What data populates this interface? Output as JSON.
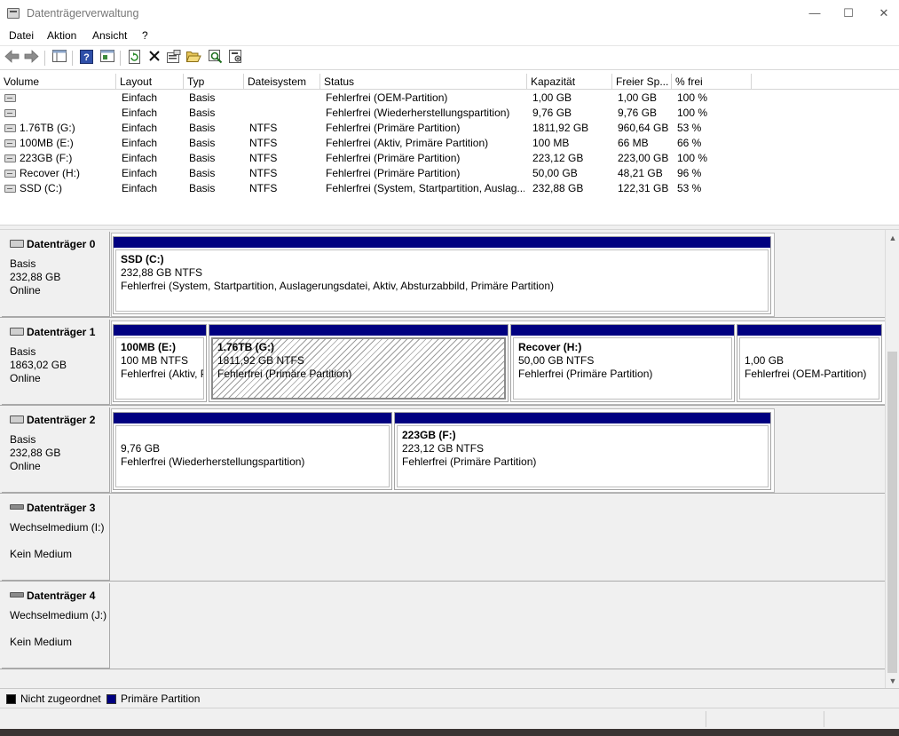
{
  "window": {
    "title": "Datenträgerverwaltung",
    "minimize_glyph": "—",
    "maximize_glyph": "☐",
    "close_glyph": "✕"
  },
  "menu": [
    "Datei",
    "Aktion",
    "Ansicht",
    "?"
  ],
  "toolbar": {
    "icons": [
      "back-arrow-icon",
      "forward-arrow-icon",
      "console-tree-icon",
      "help-icon",
      "details-pane-icon",
      "refresh-icon",
      "delete-icon",
      "properties-icon",
      "open-folder-icon",
      "rescan-icon",
      "settings-icon"
    ]
  },
  "volume_list": {
    "columns": [
      "Volume",
      "Layout",
      "Typ",
      "Dateisystem",
      "Status",
      "Kapazität",
      "Freier Sp...",
      "% frei"
    ],
    "rows": [
      {
        "volume": "",
        "layout": "Einfach",
        "typ": "Basis",
        "fs": "",
        "status": "Fehlerfrei (OEM-Partition)",
        "capacity": "1,00 GB",
        "free": "1,00 GB",
        "pct": "100 %"
      },
      {
        "volume": "",
        "layout": "Einfach",
        "typ": "Basis",
        "fs": "",
        "status": "Fehlerfrei (Wiederherstellungspartition)",
        "capacity": "9,76 GB",
        "free": "9,76 GB",
        "pct": "100 %"
      },
      {
        "volume": "1.76TB (G:)",
        "layout": "Einfach",
        "typ": "Basis",
        "fs": "NTFS",
        "status": "Fehlerfrei (Primäre Partition)",
        "capacity": "1811,92 GB",
        "free": "960,64 GB",
        "pct": "53 %"
      },
      {
        "volume": "100MB (E:)",
        "layout": "Einfach",
        "typ": "Basis",
        "fs": "NTFS",
        "status": "Fehlerfrei (Aktiv, Primäre Partition)",
        "capacity": "100 MB",
        "free": "66 MB",
        "pct": "66 %"
      },
      {
        "volume": "223GB (F:)",
        "layout": "Einfach",
        "typ": "Basis",
        "fs": "NTFS",
        "status": "Fehlerfrei (Primäre Partition)",
        "capacity": "223,12 GB",
        "free": "223,00 GB",
        "pct": "100 %"
      },
      {
        "volume": "Recover (H:)",
        "layout": "Einfach",
        "typ": "Basis",
        "fs": "NTFS",
        "status": "Fehlerfrei (Primäre Partition)",
        "capacity": "50,00 GB",
        "free": "48,21 GB",
        "pct": "96 %"
      },
      {
        "volume": "SSD (C:)",
        "layout": "Einfach",
        "typ": "Basis",
        "fs": "NTFS",
        "status": "Fehlerfrei (System, Startpartition, Auslag...",
        "capacity": "232,88 GB",
        "free": "122,31 GB",
        "pct": "53 %"
      }
    ]
  },
  "disks": [
    {
      "name": "Datenträger 0",
      "line1": "Basis",
      "line2": "232,88 GB",
      "line3": "Online",
      "partitions": [
        {
          "name": "SSD  (C:)",
          "size": "232,88 GB NTFS",
          "status": "Fehlerfrei (System, Startpartition, Auslagerungsdatei, Aktiv, Absturzabbild, Primäre Partition)"
        }
      ]
    },
    {
      "name": "Datenträger 1",
      "line1": "Basis",
      "line2": "1863,02 GB",
      "line3": "Online",
      "partitions": [
        {
          "name": "100MB  (E:)",
          "size": "100 MB NTFS",
          "status": "Fehlerfrei (Aktiv, Primäre Partition)"
        },
        {
          "name": "1.76TB  (G:)",
          "size": "1811,92 GB NTFS",
          "status": "Fehlerfrei (Primäre Partition)"
        },
        {
          "name": "Recover  (H:)",
          "size": "50,00 GB NTFS",
          "status": "Fehlerfrei (Primäre Partition)"
        },
        {
          "name": "",
          "size": "1,00 GB",
          "status": "Fehlerfrei (OEM-Partition)"
        }
      ]
    },
    {
      "name": "Datenträger 2",
      "line1": "Basis",
      "line2": "232,88 GB",
      "line3": "Online",
      "partitions": [
        {
          "name": "",
          "size": "9,76 GB",
          "status": "Fehlerfrei (Wiederherstellungspartition)"
        },
        {
          "name": "223GB  (F:)",
          "size": "223,12 GB NTFS",
          "status": "Fehlerfrei (Primäre Partition)"
        }
      ]
    },
    {
      "name": "Datenträger 3",
      "line1": "Wechselmedium (I:)",
      "line2": "",
      "line3": "Kein Medium",
      "partitions": []
    },
    {
      "name": "Datenträger 4",
      "line1": "Wechselmedium (J:)",
      "line2": "",
      "line3": "Kein Medium",
      "partitions": []
    }
  ],
  "legend": {
    "unallocated": {
      "label": "Nicht zugeordnet",
      "color": "#000000"
    },
    "primary": {
      "label": "Primäre Partition",
      "color": "#000080"
    }
  },
  "scrollbar": {
    "up_glyph": "▲",
    "down_glyph": "▼"
  },
  "colors": {
    "partition_bar": "#000080",
    "disk_area_bg": "#f0f0f0"
  }
}
